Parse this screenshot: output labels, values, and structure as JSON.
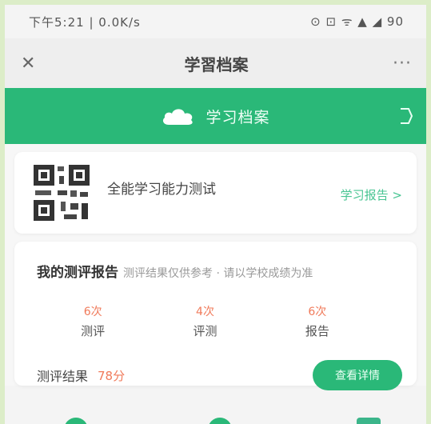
{
  "status_bar": {
    "left": "下午5:21 | 0.0K/s",
    "right": "⊙ ⊡ ᯤ ▲ ◢ 90"
  },
  "nav": {
    "close": "✕",
    "title": "学習档案",
    "more": "···"
  },
  "header": {
    "title": "学习档案",
    "icon": "cloud-icon",
    "right_icon": "share-icon"
  },
  "summary": {
    "qr_icon": "qr-code-icon",
    "name": "全能学习能力测试",
    "link": "学习报告 >"
  },
  "detail": {
    "heading": "我的测评报告",
    "subheading": "测评结果仅供参考 · 请以学校成绩为准",
    "stats": [
      {
        "value": "6次",
        "label": "测评"
      },
      {
        "value": "4次",
        "label": "评测"
      },
      {
        "value": "6次",
        "label": "报告"
      }
    ],
    "result_label": "测评结果",
    "result_value": "78分",
    "result_button": "查看详情"
  },
  "colors": {
    "green": "#2ab878",
    "accent": "#f07a5a",
    "link": "#49c593",
    "frame": "#dcedc8"
  }
}
